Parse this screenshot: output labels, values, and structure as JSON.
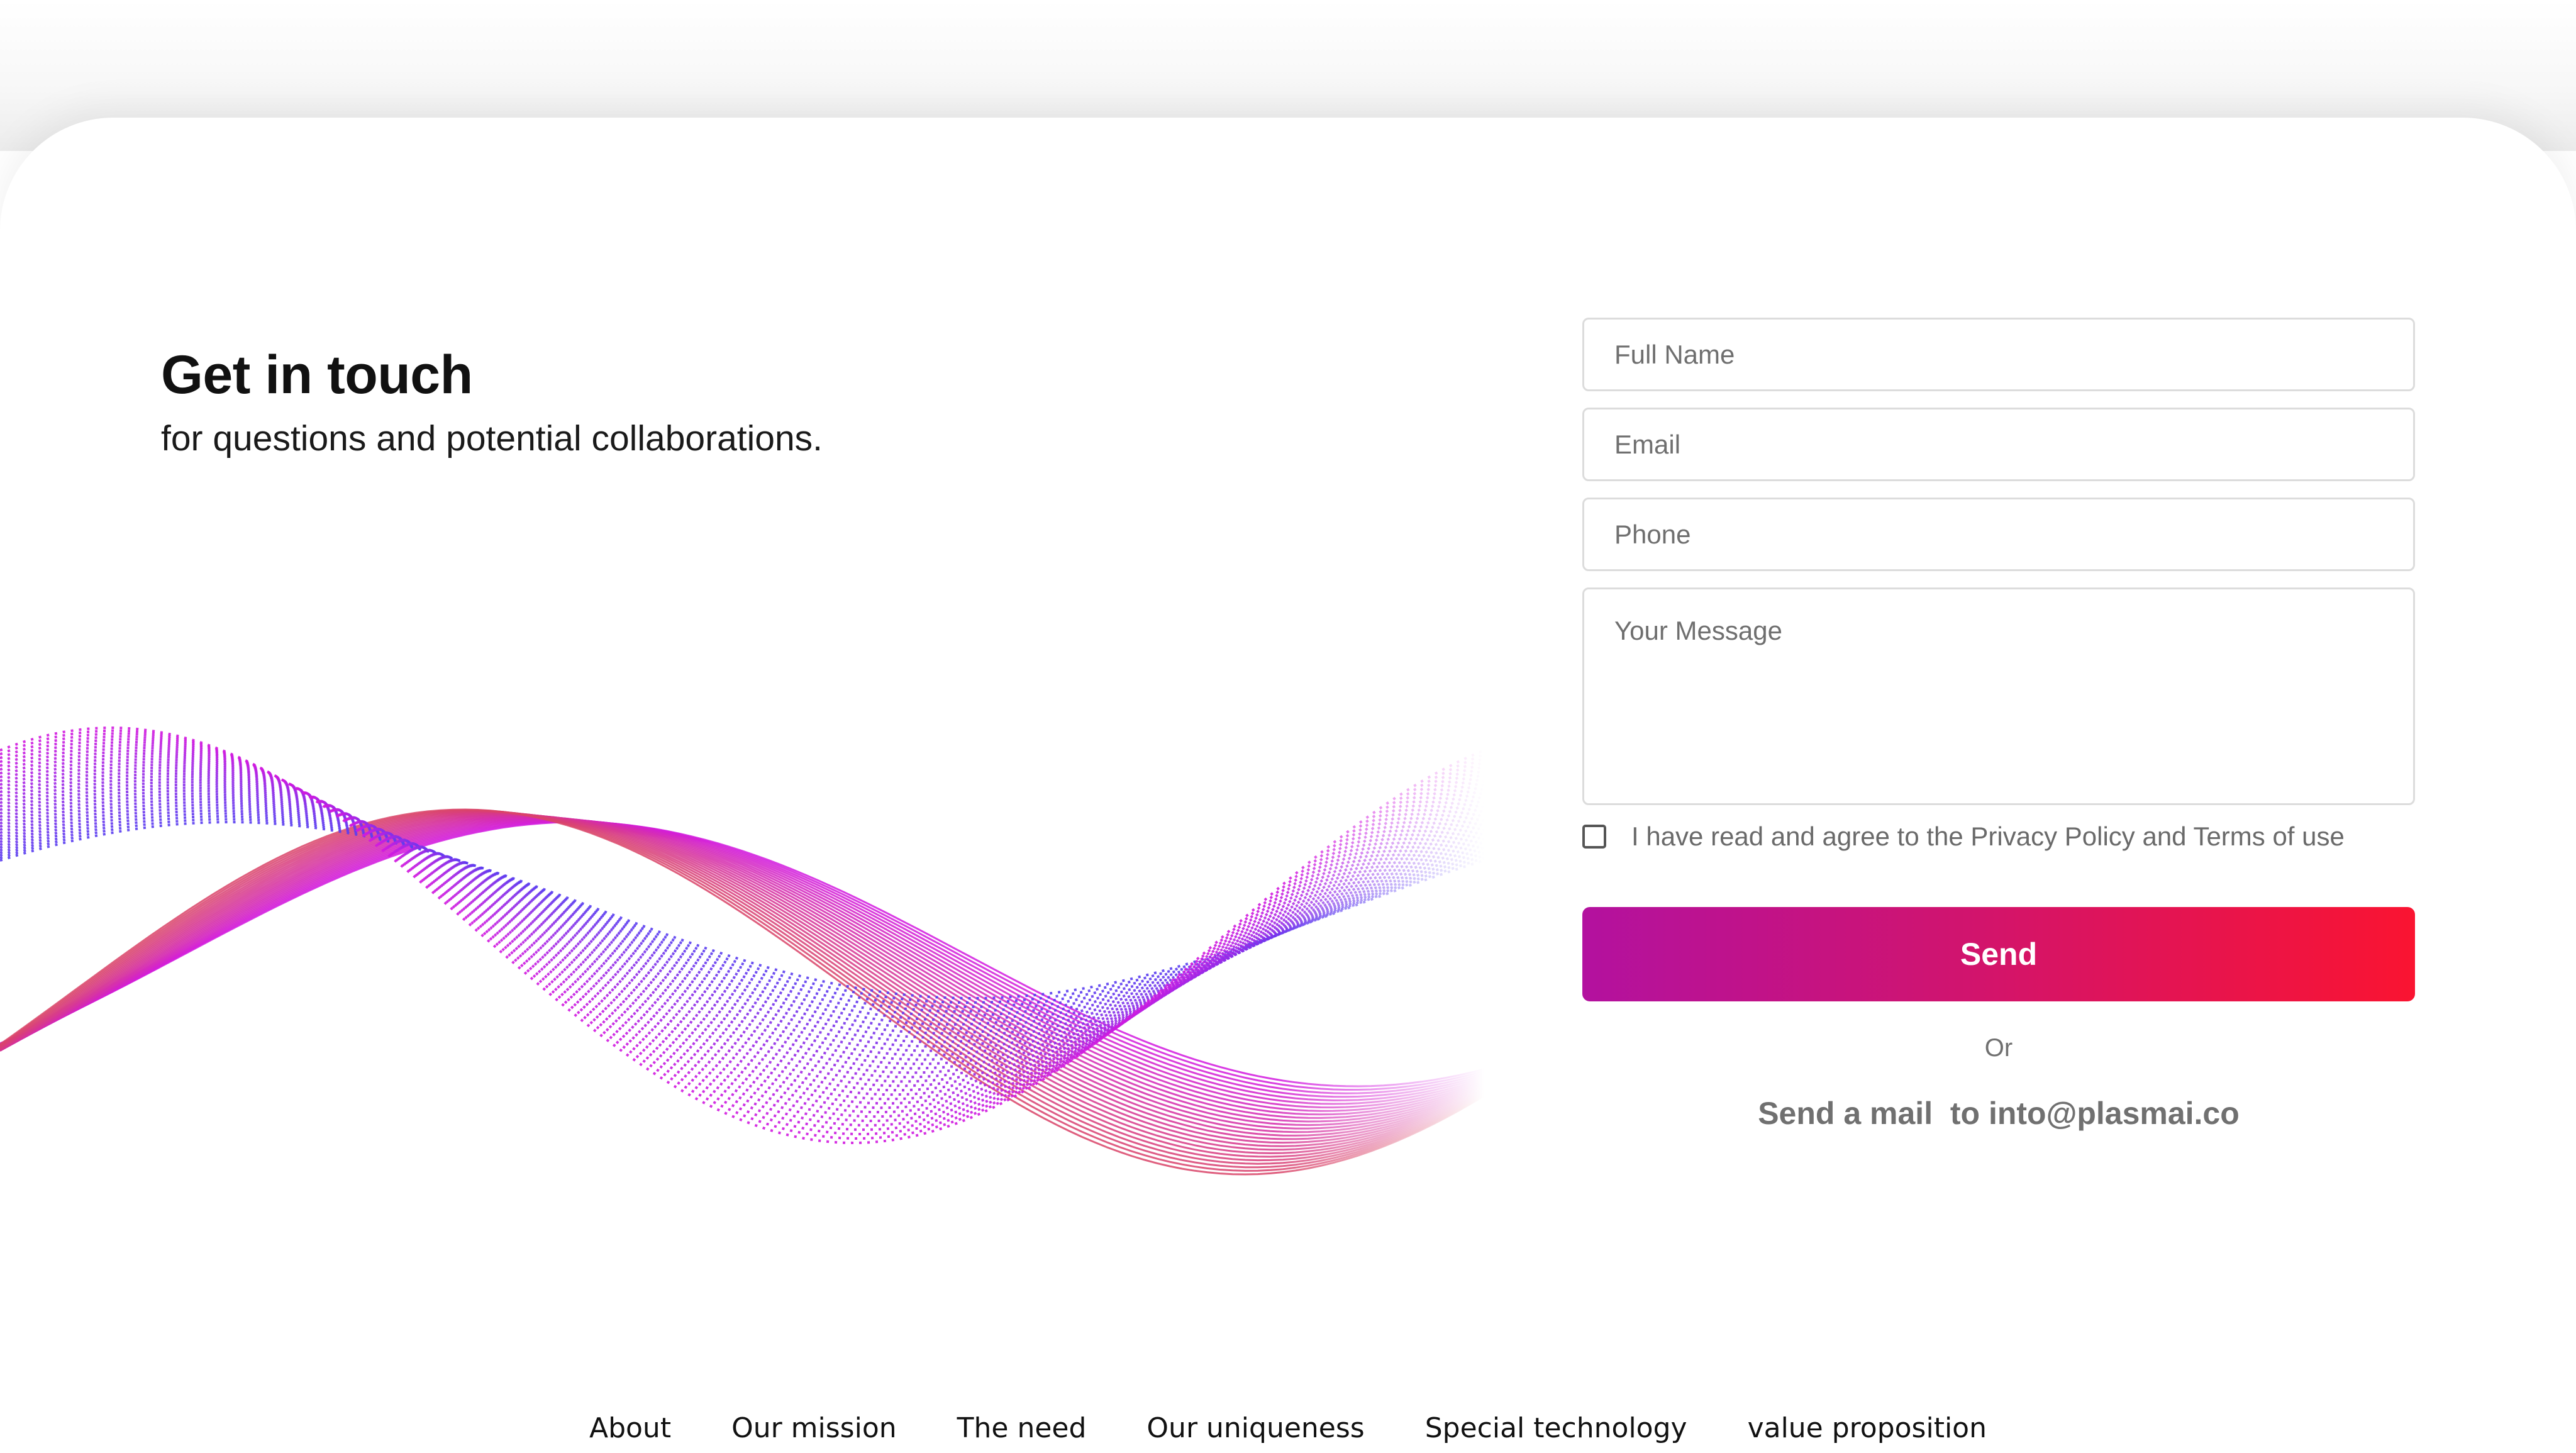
{
  "hero": {
    "title": "Get in touch",
    "subtitle": "for questions and potential collaborations."
  },
  "form": {
    "full_name_placeholder": "Full Name",
    "email_placeholder": "Email",
    "phone_placeholder": "Phone",
    "message_placeholder": "Your Message",
    "consent_label": "I have read and agree to the Privacy Policy and Terms of use",
    "consent_checked": false,
    "send_label": "Send",
    "or_label": "Or",
    "mail_line": "Send a mail  to into@plasmai.co"
  },
  "footer": {
    "links": [
      {
        "label": "About"
      },
      {
        "label": "Our mission"
      },
      {
        "label": "The need"
      },
      {
        "label": "Our uniqueness"
      },
      {
        "label": "Special technology"
      },
      {
        "label": "value proposition"
      }
    ]
  },
  "colors": {
    "send_gradient_start": "#b3119f",
    "send_gradient_end": "#fa1431",
    "wave_blue": "#5a3ef0",
    "wave_magenta": "#d21adf",
    "wave_red": "#d94468"
  },
  "icons": {
    "decorative_wave": "particle-wave-illustration"
  }
}
